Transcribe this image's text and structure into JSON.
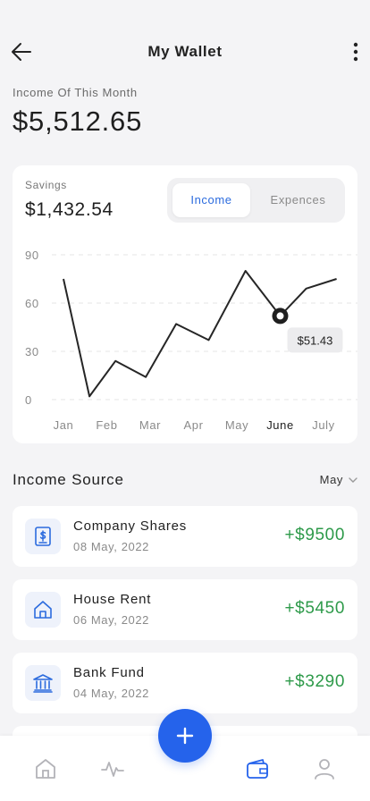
{
  "header": {
    "title": "My Wallet",
    "back_icon": "arrow-left-icon",
    "more_icon": "more-vertical-icon"
  },
  "income": {
    "label": "Income Of This Month",
    "value": "$5,512.65"
  },
  "savings": {
    "label": "Savings",
    "value": "$1,432.54"
  },
  "toggle": {
    "options": [
      "Income",
      "Expences"
    ],
    "selected": "Income"
  },
  "chart_data": {
    "type": "line",
    "categories": [
      "Jan",
      "Feb",
      "Mar",
      "Apr",
      "May",
      "June",
      "July"
    ],
    "selected_category": "June",
    "points": [
      {
        "x": 0.0,
        "y": 75
      },
      {
        "x": 0.6,
        "y": 2
      },
      {
        "x": 1.2,
        "y": 24
      },
      {
        "x": 1.9,
        "y": 14
      },
      {
        "x": 2.6,
        "y": 47
      },
      {
        "x": 3.35,
        "y": 37
      },
      {
        "x": 4.2,
        "y": 80
      },
      {
        "x": 5.0,
        "y": 52
      },
      {
        "x": 5.6,
        "y": 69
      },
      {
        "x": 6.3,
        "y": 75
      }
    ],
    "highlight": {
      "x": 5.0,
      "y": 52,
      "label": "$51.43"
    },
    "yticks": [
      0,
      30,
      60,
      90
    ],
    "ylim": [
      0,
      90
    ],
    "grid": true,
    "line_color": "#262626"
  },
  "income_source": {
    "title": "Income Source",
    "month": "May",
    "items": [
      {
        "name": "Company Shares",
        "date": "08 May, 2022",
        "amount": "+$9500",
        "icon": "document-dollar-icon"
      },
      {
        "name": "House Rent",
        "date": "06 May, 2022",
        "amount": "+$5450",
        "icon": "house-icon"
      },
      {
        "name": "Bank Fund",
        "date": "04 May, 2022",
        "amount": "+$3290",
        "icon": "bank-icon"
      }
    ]
  },
  "tabbar": {
    "items": [
      "home-icon",
      "activity-icon",
      "wallet-icon",
      "profile-icon"
    ],
    "active": "wallet-icon",
    "fab_icon": "plus-icon"
  },
  "colors": {
    "accent": "#2563eb",
    "positive": "#2e9a4a",
    "background": "#f4f4f6"
  }
}
